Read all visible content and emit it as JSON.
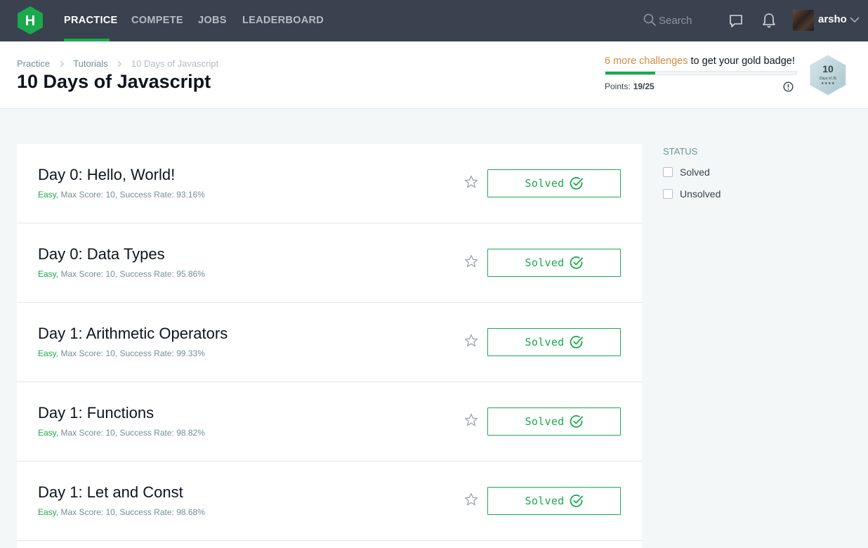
{
  "nav": {
    "items": [
      {
        "label": "PRACTICE",
        "active": true
      },
      {
        "label": "COMPETE",
        "active": false
      },
      {
        "label": "JOBS",
        "active": false
      },
      {
        "label": "LEADERBOARD",
        "active": false
      }
    ],
    "logo_letter": "H",
    "search_placeholder": "Search",
    "username": "arsho",
    "icons": {
      "search": "search-icon",
      "messages": "chat-bubble-icon",
      "notifications": "bell-icon",
      "user_menu": "chevron-down-icon"
    }
  },
  "breadcrumb": [
    "Practice",
    "Tutorials",
    "10 Days of Javascript"
  ],
  "page_title": "10 Days of Javascript",
  "badge": {
    "challenges_highlight": "6 more challenges",
    "message_rest": " to get your gold badge!",
    "points_label": "Points:",
    "points_value": "19/25",
    "progress_fraction": 0.26,
    "badge_number": "10",
    "badge_caption": "Days of JS",
    "badge_stars": "★★★★"
  },
  "challenges": [
    {
      "title": "Day 0: Hello, World!",
      "difficulty": "Easy,",
      "meta": " Max Score: 10, Success Rate: 93.16%",
      "status": "Solved"
    },
    {
      "title": "Day 0: Data Types",
      "difficulty": "Easy,",
      "meta": " Max Score: 10, Success Rate: 95.86%",
      "status": "Solved"
    },
    {
      "title": "Day 1: Arithmetic Operators",
      "difficulty": "Easy,",
      "meta": " Max Score: 10, Success Rate: 99.33%",
      "status": "Solved"
    },
    {
      "title": "Day 1: Functions",
      "difficulty": "Easy,",
      "meta": " Max Score: 10, Success Rate: 98.82%",
      "status": "Solved"
    },
    {
      "title": "Day 1: Let and Const",
      "difficulty": "Easy,",
      "meta": " Max Score: 10, Success Rate: 98.68%",
      "status": "Solved"
    }
  ],
  "status_filter": {
    "heading": "STATUS",
    "options": [
      {
        "label": "Solved",
        "checked": false
      },
      {
        "label": "Unsolved",
        "checked": false
      }
    ]
  },
  "colors": {
    "nav_bg": "#39424e",
    "brand_green": "#1ba94c",
    "highlight_orange": "#d08c3c",
    "page_bg": "#f3f7f7"
  }
}
